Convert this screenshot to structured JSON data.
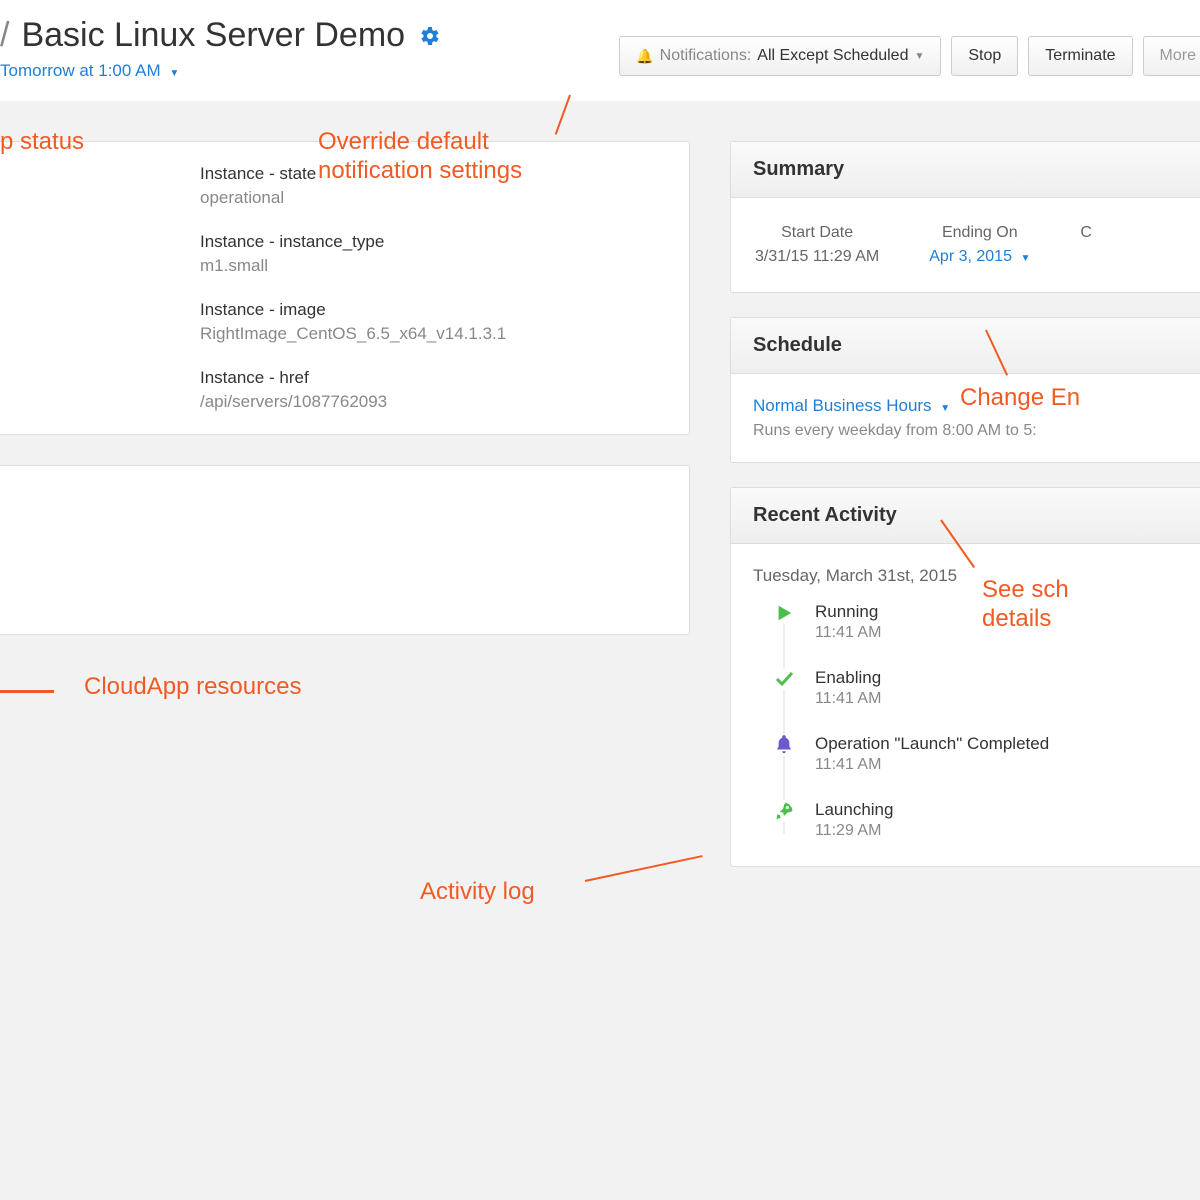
{
  "header": {
    "title": "Basic Linux Server Demo",
    "schedule_link": "Tomorrow at 1:00 AM",
    "notifications_prefix": "Notifications:",
    "notifications_value": "All Except Scheduled",
    "stop": "Stop",
    "terminate": "Terminate",
    "more": "More"
  },
  "annotations": {
    "status": "p status",
    "override": "Override default\nnotification settings",
    "resources": "CloudApp resources",
    "activity": "Activity log",
    "change_end": "Change En",
    "see_sched": "See sch\ndetails"
  },
  "instance": {
    "state_label": "Instance - state",
    "state_value": "operational",
    "type_label": "Instance - instance_type",
    "type_value": "m1.small",
    "image_label": "Instance - image",
    "image_value": "RightImage_CentOS_6.5_x64_v14.1.3.1",
    "href_label": "Instance - href",
    "href_value": "/api/servers/1087762093"
  },
  "summary": {
    "title": "Summary",
    "start_label": "Start Date",
    "start_value": "3/31/15 11:29 AM",
    "end_label": "Ending On",
    "end_value": "Apr 3, 2015",
    "extra_label": "C"
  },
  "schedule": {
    "title": "Schedule",
    "link": "Normal Business Hours",
    "desc": "Runs every weekday from 8:00 AM to 5:"
  },
  "activity": {
    "title": "Recent Activity",
    "date": "Tuesday, March 31st, 2015",
    "items": [
      {
        "icon": "play",
        "title": "Running",
        "time": "11:41 AM"
      },
      {
        "icon": "check",
        "title": "Enabling",
        "time": "11:41 AM"
      },
      {
        "icon": "bell",
        "title": "Operation \"Launch\" Completed",
        "time": "11:41 AM"
      },
      {
        "icon": "rocket",
        "title": "Launching",
        "time": "11:29 AM"
      }
    ]
  }
}
